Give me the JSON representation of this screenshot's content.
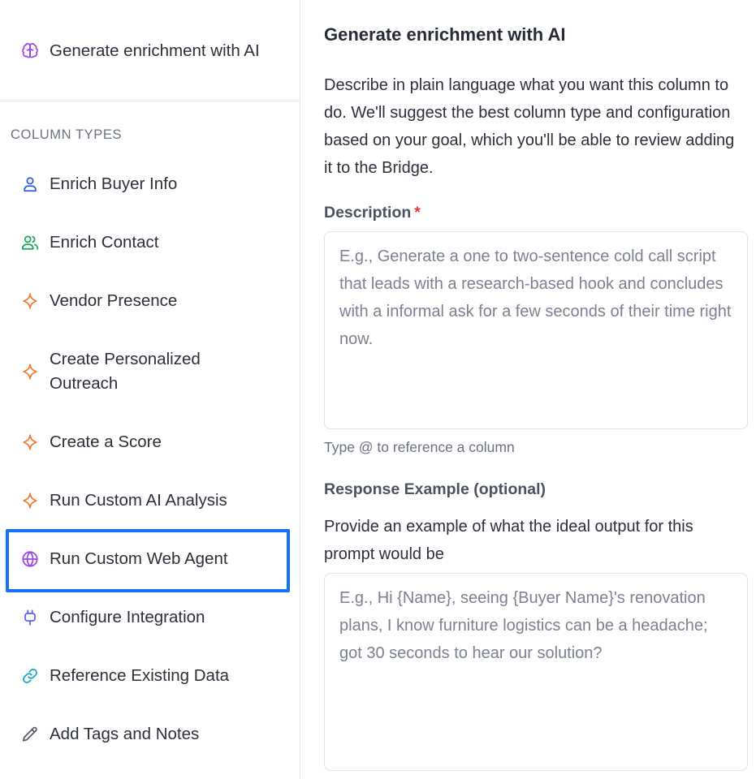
{
  "sidebar": {
    "top_item": {
      "label": "Generate enrichment with AI",
      "icon": "brain-icon"
    },
    "section_label": "COLUMN TYPES",
    "items": [
      {
        "label": "Enrich Buyer Info",
        "icon": "user-icon"
      },
      {
        "label": "Enrich Contact",
        "icon": "users-icon"
      },
      {
        "label": "Vendor Presence",
        "icon": "sparkle-icon"
      },
      {
        "label": "Create Personalized Outreach",
        "icon": "sparkle-icon"
      },
      {
        "label": "Create a Score",
        "icon": "sparkle-icon"
      },
      {
        "label": "Run Custom AI Analysis",
        "icon": "sparkle-icon"
      },
      {
        "label": "Run Custom Web Agent",
        "icon": "globe-icon"
      },
      {
        "label": "Configure Integration",
        "icon": "plug-icon"
      },
      {
        "label": "Reference Existing Data",
        "icon": "link-icon"
      },
      {
        "label": "Add Tags and Notes",
        "icon": "pencil-icon"
      }
    ]
  },
  "main": {
    "title": "Generate enrichment with AI",
    "description": "Describe in plain language what you want this column to do. We'll suggest the best column type and configuration based on your goal, which you'll be able to review adding it to the Bridge.",
    "description_field": {
      "label": "Description",
      "required_mark": "*",
      "placeholder": "E.g., Generate a one to two-sentence cold call script that leads with a research-based hook and concludes with a informal ask for a few seconds of their time right now.",
      "value": "",
      "hint": "Type @ to reference a column"
    },
    "response_field": {
      "label": "Response Example (optional)",
      "help": "Provide an example of what the ideal output for this prompt would be",
      "placeholder": "E.g., Hi {Name}, seeing {Buyer Name}'s renovation plans, I know furniture logistics can be a headache; got 30 seconds to hear our solution?",
      "value": ""
    }
  },
  "colors": {
    "highlight": "#1473f5",
    "user": "#2f5fe0",
    "users": "#1aa655",
    "sparkle": "#f07830",
    "globe": "#9b45e6",
    "plug": "#5b5ff0",
    "link": "#17a9c4",
    "pencil": "#555b66",
    "brain": "#9b45e6"
  }
}
